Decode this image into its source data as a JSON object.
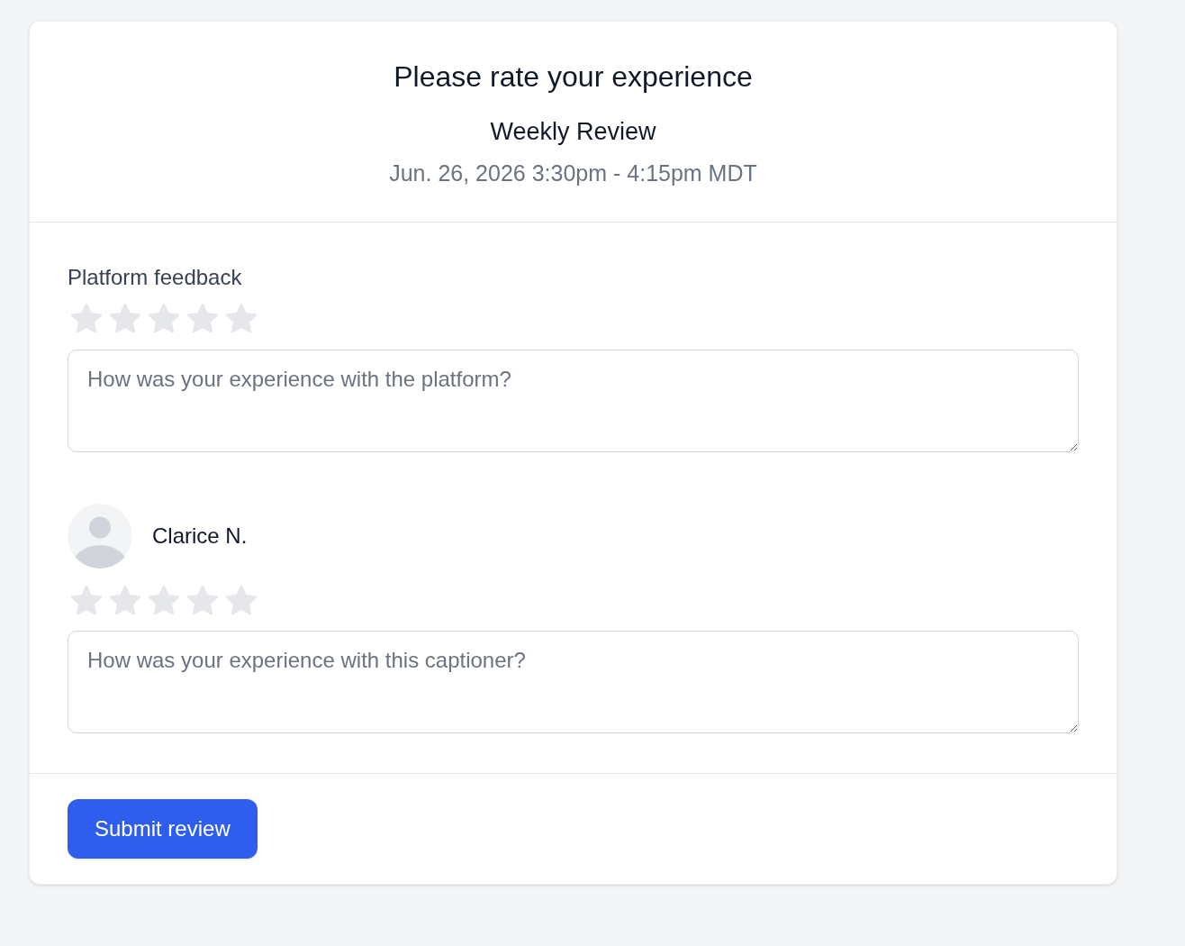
{
  "header": {
    "title": "Please rate your experience",
    "event_name": "Weekly Review",
    "datetime": "Jun. 26, 2026 3:30pm - 4:15pm MDT"
  },
  "sections": [
    {
      "kind": "platform",
      "label": "Platform feedback",
      "stars": 0,
      "comment": {
        "placeholder": "How was your experience with the platform?"
      }
    },
    {
      "kind": "person",
      "name": "Clarice N.",
      "stars": 0,
      "comment": {
        "placeholder": "How was your experience with this captioner?"
      }
    }
  ],
  "submit_button": {
    "label": "Submit review"
  }
}
